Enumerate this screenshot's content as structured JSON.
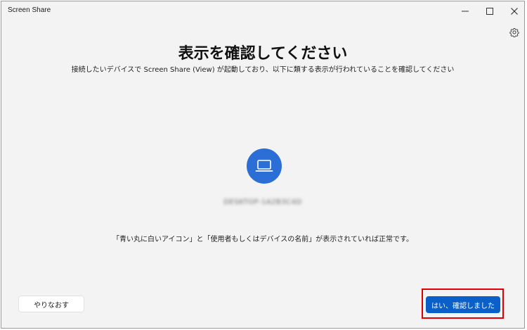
{
  "window": {
    "title": "Screen Share"
  },
  "main": {
    "heading": "表示を確認してください",
    "subheading": "接続したいデバイスで Screen Share (View) が起動しており、以下に類する表示が行われていることを確認してください",
    "device_icon": "laptop-icon",
    "device_name": "DESKTOP-1A2B3C4D",
    "status_note": "「青い丸に白いアイコン」と「使用者もしくはデバイスの名前」が表示されていれば正常です。"
  },
  "buttons": {
    "retry_label": "やりなおす",
    "confirm_label": "はい、確認しました"
  },
  "colors": {
    "accent": "#0a5fc8",
    "device_circle": "#2b6fd6",
    "highlight": "#e10000",
    "background": "#f3f3f3"
  }
}
